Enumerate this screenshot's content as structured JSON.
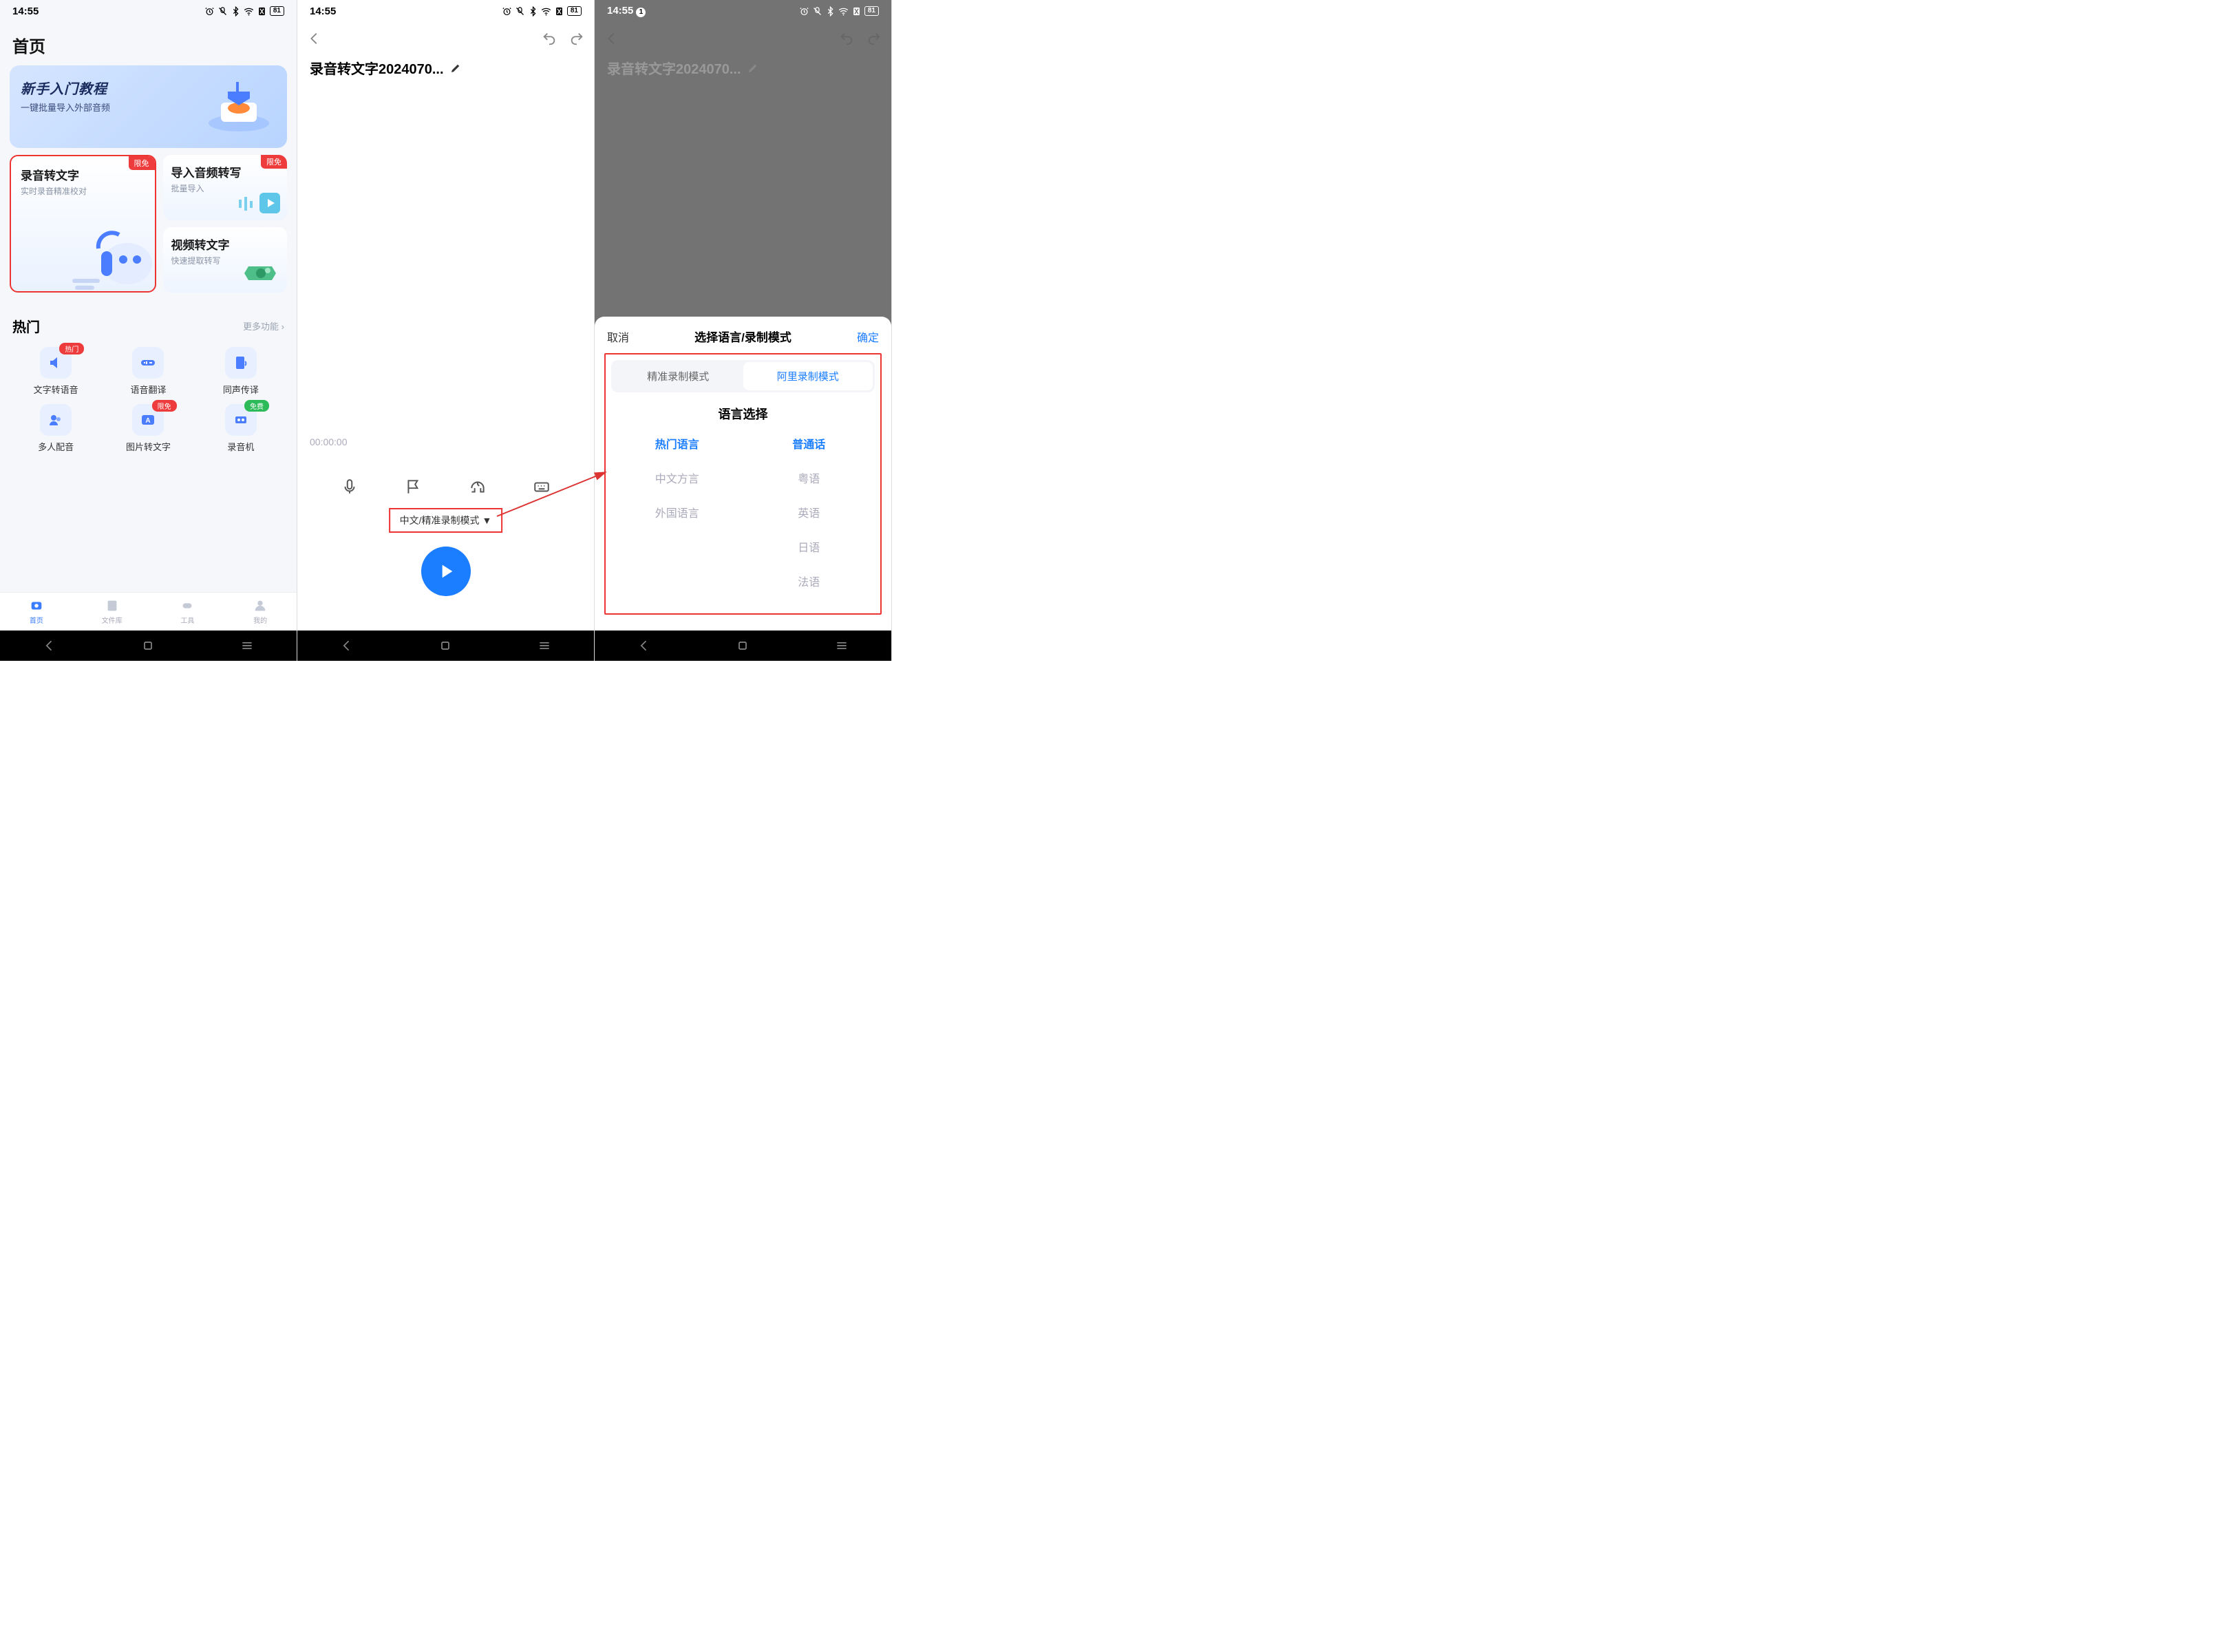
{
  "status": {
    "time": "14:55",
    "battery": "81",
    "notif_count": "1"
  },
  "screen1": {
    "title": "首页",
    "banner": {
      "title": "新手入门教程",
      "subtitle": "一键批量导入外部音频"
    },
    "badge_free": "限免",
    "card_big": {
      "title": "录音转文字",
      "subtitle": "实时录音精准校对"
    },
    "card_import": {
      "title": "导入音频转写",
      "subtitle": "批量导入"
    },
    "card_video": {
      "title": "视频转文字",
      "subtitle": "快速提取转写"
    },
    "hot_title": "热门",
    "hot_more": "更多功能",
    "tools": [
      {
        "label": "文字转语音",
        "badge": "热门",
        "badge_class": "badge-red"
      },
      {
        "label": "语音翻译"
      },
      {
        "label": "同声传译"
      },
      {
        "label": "多人配音"
      },
      {
        "label": "图片转文字",
        "badge": "限免",
        "badge_class": "badge-red"
      },
      {
        "label": "录音机",
        "badge": "免费",
        "badge_class": "badge-green"
      }
    ],
    "tabs": [
      {
        "label": "首页",
        "active": true
      },
      {
        "label": "文件库"
      },
      {
        "label": "工具"
      },
      {
        "label": "我的"
      }
    ]
  },
  "screen2": {
    "doc_title": "录音转文字2024070...",
    "timer": "00:00:00",
    "mode_pill": "中文/精准录制模式"
  },
  "screen3": {
    "doc_title": "录音转文字2024070...",
    "cancel": "取消",
    "sheet_title": "选择语言/录制模式",
    "confirm": "确定",
    "mode_tabs": [
      "精准录制模式",
      "阿里录制模式"
    ],
    "lang_section_title": "语言选择",
    "left_col": [
      "热门语言",
      "中文方言",
      "外国语言"
    ],
    "right_col": [
      "普通话",
      "粤语",
      "英语",
      "日语",
      "法语"
    ]
  }
}
